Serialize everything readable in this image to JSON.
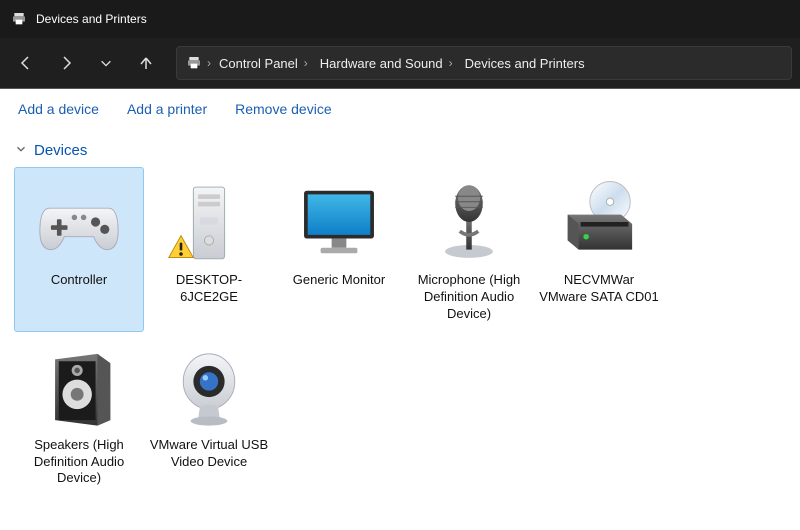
{
  "window": {
    "title": "Devices and Printers"
  },
  "breadcrumb": {
    "root_icon": "devices-printers-icon",
    "items": [
      "Control Panel",
      "Hardware and Sound",
      "Devices and Printers"
    ]
  },
  "toolbar": {
    "add_device": "Add a device",
    "add_printer": "Add a printer",
    "remove_device": "Remove device"
  },
  "group": {
    "title": "Devices"
  },
  "devices": [
    {
      "name": "Controller",
      "icon": "controller",
      "selected": true,
      "warning": false
    },
    {
      "name": "DESKTOP-6JCE2GE",
      "icon": "tower",
      "selected": false,
      "warning": true
    },
    {
      "name": "Generic Monitor",
      "icon": "monitor",
      "selected": false,
      "warning": false
    },
    {
      "name": "Microphone (High Definition Audio Device)",
      "icon": "microphone",
      "selected": false,
      "warning": false
    },
    {
      "name": "NECVMWar VMware SATA CD01",
      "icon": "optical",
      "selected": false,
      "warning": false
    },
    {
      "name": "Speakers (High Definition Audio Device)",
      "icon": "speaker",
      "selected": false,
      "warning": false
    },
    {
      "name": "VMware Virtual USB Video Device",
      "icon": "webcam",
      "selected": false,
      "warning": false
    }
  ]
}
